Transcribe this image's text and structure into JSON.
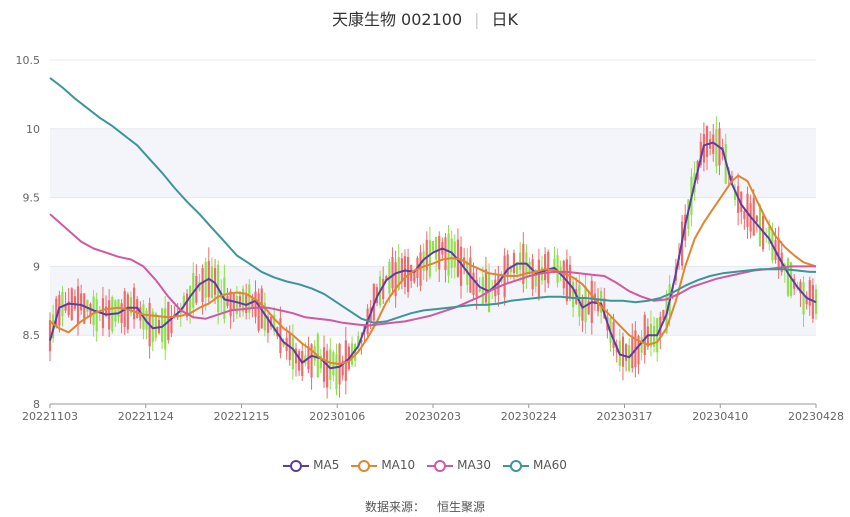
{
  "chart_data": {
    "type": "candlestick",
    "title": "天康生物 002100",
    "period_label": "日K",
    "ylim": [
      8,
      10.5
    ],
    "y_ticks": [
      "8",
      "8.5",
      "9",
      "9.5",
      "10",
      "10.5"
    ],
    "x_tick_labels": [
      "20221103",
      "20221124",
      "20221215",
      "20230106",
      "20230203",
      "20230224",
      "20230317",
      "20230410",
      "20230428"
    ],
    "grid": true,
    "legend_position": "bottom",
    "up_color": "#ef6b6b",
    "down_color": "#8fe04f",
    "series": [
      {
        "name": "MA5",
        "color": "#5b3ea3",
        "points": [
          [
            0,
            8.46
          ],
          [
            3,
            8.7
          ],
          [
            6,
            8.73
          ],
          [
            10,
            8.72
          ],
          [
            14,
            8.68
          ],
          [
            18,
            8.65
          ],
          [
            22,
            8.66
          ],
          [
            25,
            8.7
          ],
          [
            28,
            8.7
          ],
          [
            31,
            8.6
          ],
          [
            33,
            8.55
          ],
          [
            36,
            8.56
          ],
          [
            39,
            8.62
          ],
          [
            42,
            8.68
          ],
          [
            45,
            8.78
          ],
          [
            48,
            8.87
          ],
          [
            51,
            8.91
          ],
          [
            53,
            8.88
          ],
          [
            56,
            8.76
          ],
          [
            60,
            8.74
          ],
          [
            63,
            8.72
          ],
          [
            66,
            8.75
          ],
          [
            69,
            8.65
          ],
          [
            72,
            8.55
          ],
          [
            75,
            8.45
          ],
          [
            78,
            8.4
          ],
          [
            81,
            8.3
          ],
          [
            84,
            8.35
          ],
          [
            87,
            8.33
          ],
          [
            90,
            8.26
          ],
          [
            93,
            8.27
          ],
          [
            96,
            8.33
          ],
          [
            99,
            8.42
          ],
          [
            102,
            8.6
          ],
          [
            105,
            8.78
          ],
          [
            108,
            8.9
          ],
          [
            111,
            8.95
          ],
          [
            114,
            8.97
          ],
          [
            117,
            8.96
          ],
          [
            120,
            9.05
          ],
          [
            123,
            9.1
          ],
          [
            126,
            9.13
          ],
          [
            129,
            9.1
          ],
          [
            132,
            9.02
          ],
          [
            135,
            8.93
          ],
          [
            138,
            8.85
          ],
          [
            141,
            8.82
          ],
          [
            144,
            8.88
          ],
          [
            147,
            8.98
          ],
          [
            150,
            9.02
          ],
          [
            153,
            9.02
          ],
          [
            156,
            8.95
          ],
          [
            159,
            8.97
          ],
          [
            162,
            8.99
          ],
          [
            165,
            8.92
          ],
          [
            168,
            8.84
          ],
          [
            171,
            8.7
          ],
          [
            174,
            8.74
          ],
          [
            177,
            8.73
          ],
          [
            180,
            8.52
          ],
          [
            183,
            8.36
          ],
          [
            186,
            8.34
          ],
          [
            189,
            8.42
          ],
          [
            192,
            8.5
          ],
          [
            195,
            8.5
          ],
          [
            198,
            8.65
          ],
          [
            201,
            8.95
          ],
          [
            204,
            9.3
          ],
          [
            207,
            9.6
          ],
          [
            210,
            9.88
          ],
          [
            213,
            9.9
          ],
          [
            216,
            9.85
          ],
          [
            219,
            9.6
          ],
          [
            222,
            9.45
          ],
          [
            225,
            9.36
          ],
          [
            228,
            9.28
          ],
          [
            231,
            9.2
          ],
          [
            234,
            9.07
          ],
          [
            237,
            8.95
          ],
          [
            240,
            8.85
          ],
          [
            243,
            8.77
          ],
          [
            246,
            8.74
          ]
        ]
      },
      {
        "name": "MA10",
        "color": "#e0862e",
        "points": [
          [
            0,
            8.6
          ],
          [
            3,
            8.55
          ],
          [
            6,
            8.52
          ],
          [
            10,
            8.6
          ],
          [
            14,
            8.66
          ],
          [
            18,
            8.69
          ],
          [
            22,
            8.7
          ],
          [
            26,
            8.68
          ],
          [
            30,
            8.65
          ],
          [
            34,
            8.64
          ],
          [
            38,
            8.63
          ],
          [
            42,
            8.64
          ],
          [
            45,
            8.66
          ],
          [
            48,
            8.7
          ],
          [
            51,
            8.73
          ],
          [
            54,
            8.78
          ],
          [
            57,
            8.8
          ],
          [
            60,
            8.81
          ],
          [
            63,
            8.8
          ],
          [
            66,
            8.76
          ],
          [
            69,
            8.7
          ],
          [
            72,
            8.62
          ],
          [
            75,
            8.55
          ],
          [
            78,
            8.5
          ],
          [
            81,
            8.44
          ],
          [
            84,
            8.39
          ],
          [
            87,
            8.33
          ],
          [
            90,
            8.3
          ],
          [
            93,
            8.29
          ],
          [
            96,
            8.31
          ],
          [
            99,
            8.38
          ],
          [
            102,
            8.48
          ],
          [
            105,
            8.6
          ],
          [
            108,
            8.74
          ],
          [
            111,
            8.84
          ],
          [
            114,
            8.92
          ],
          [
            117,
            8.97
          ],
          [
            120,
            9.0
          ],
          [
            123,
            9.02
          ],
          [
            126,
            9.05
          ],
          [
            129,
            9.06
          ],
          [
            132,
            9.05
          ],
          [
            135,
            9.01
          ],
          [
            138,
            8.98
          ],
          [
            141,
            8.95
          ],
          [
            144,
            8.94
          ],
          [
            147,
            8.93
          ],
          [
            150,
            8.93
          ],
          [
            153,
            8.95
          ],
          [
            156,
            8.96
          ],
          [
            159,
            8.98
          ],
          [
            162,
            8.97
          ],
          [
            165,
            8.95
          ],
          [
            168,
            8.92
          ],
          [
            171,
            8.87
          ],
          [
            174,
            8.79
          ],
          [
            177,
            8.71
          ],
          [
            180,
            8.64
          ],
          [
            183,
            8.57
          ],
          [
            186,
            8.5
          ],
          [
            189,
            8.46
          ],
          [
            192,
            8.43
          ],
          [
            195,
            8.45
          ],
          [
            198,
            8.55
          ],
          [
            201,
            8.75
          ],
          [
            204,
            9.0
          ],
          [
            207,
            9.2
          ],
          [
            210,
            9.32
          ],
          [
            213,
            9.42
          ],
          [
            216,
            9.52
          ],
          [
            219,
            9.62
          ],
          [
            221,
            9.66
          ],
          [
            224,
            9.62
          ],
          [
            227,
            9.48
          ],
          [
            230,
            9.34
          ],
          [
            233,
            9.22
          ],
          [
            236,
            9.14
          ],
          [
            239,
            9.08
          ],
          [
            242,
            9.03
          ],
          [
            246,
            9.0
          ]
        ]
      },
      {
        "name": "MA30",
        "color": "#d258a0",
        "points": [
          [
            0,
            9.38
          ],
          [
            5,
            9.28
          ],
          [
            10,
            9.18
          ],
          [
            14,
            9.13
          ],
          [
            18,
            9.1
          ],
          [
            22,
            9.07
          ],
          [
            26,
            9.05
          ],
          [
            30,
            9.0
          ],
          [
            34,
            8.9
          ],
          [
            38,
            8.78
          ],
          [
            42,
            8.68
          ],
          [
            46,
            8.63
          ],
          [
            50,
            8.62
          ],
          [
            54,
            8.65
          ],
          [
            58,
            8.68
          ],
          [
            62,
            8.69
          ],
          [
            66,
            8.7
          ],
          [
            70,
            8.7
          ],
          [
            74,
            8.68
          ],
          [
            78,
            8.66
          ],
          [
            82,
            8.63
          ],
          [
            86,
            8.62
          ],
          [
            90,
            8.61
          ],
          [
            94,
            8.59
          ],
          [
            98,
            8.58
          ],
          [
            102,
            8.57
          ],
          [
            106,
            8.58
          ],
          [
            110,
            8.59
          ],
          [
            114,
            8.6
          ],
          [
            118,
            8.62
          ],
          [
            122,
            8.64
          ],
          [
            126,
            8.67
          ],
          [
            130,
            8.7
          ],
          [
            134,
            8.74
          ],
          [
            138,
            8.78
          ],
          [
            142,
            8.83
          ],
          [
            146,
            8.87
          ],
          [
            150,
            8.9
          ],
          [
            154,
            8.93
          ],
          [
            158,
            8.95
          ],
          [
            162,
            8.96
          ],
          [
            166,
            8.96
          ],
          [
            170,
            8.95
          ],
          [
            174,
            8.94
          ],
          [
            178,
            8.93
          ],
          [
            182,
            8.88
          ],
          [
            186,
            8.82
          ],
          [
            190,
            8.78
          ],
          [
            194,
            8.75
          ],
          [
            198,
            8.76
          ],
          [
            202,
            8.8
          ],
          [
            206,
            8.85
          ],
          [
            210,
            8.88
          ],
          [
            214,
            8.91
          ],
          [
            218,
            8.93
          ],
          [
            222,
            8.95
          ],
          [
            226,
            8.97
          ],
          [
            230,
            8.98
          ],
          [
            234,
            8.99
          ],
          [
            238,
            9.0
          ],
          [
            242,
            9.0
          ],
          [
            246,
            9.0
          ]
        ]
      },
      {
        "name": "MA60",
        "color": "#3d9598",
        "points": [
          [
            0,
            10.37
          ],
          [
            4,
            10.3
          ],
          [
            8,
            10.22
          ],
          [
            12,
            10.15
          ],
          [
            16,
            10.08
          ],
          [
            20,
            10.02
          ],
          [
            24,
            9.95
          ],
          [
            28,
            9.88
          ],
          [
            32,
            9.78
          ],
          [
            36,
            9.68
          ],
          [
            40,
            9.57
          ],
          [
            44,
            9.47
          ],
          [
            48,
            9.38
          ],
          [
            52,
            9.28
          ],
          [
            56,
            9.18
          ],
          [
            60,
            9.08
          ],
          [
            64,
            9.02
          ],
          [
            68,
            8.96
          ],
          [
            72,
            8.92
          ],
          [
            76,
            8.89
          ],
          [
            80,
            8.87
          ],
          [
            84,
            8.84
          ],
          [
            88,
            8.8
          ],
          [
            92,
            8.74
          ],
          [
            96,
            8.68
          ],
          [
            100,
            8.62
          ],
          [
            104,
            8.59
          ],
          [
            108,
            8.6
          ],
          [
            112,
            8.63
          ],
          [
            116,
            8.66
          ],
          [
            120,
            8.68
          ],
          [
            124,
            8.69
          ],
          [
            128,
            8.7
          ],
          [
            132,
            8.71
          ],
          [
            136,
            8.72
          ],
          [
            140,
            8.72
          ],
          [
            144,
            8.73
          ],
          [
            148,
            8.75
          ],
          [
            152,
            8.76
          ],
          [
            156,
            8.77
          ],
          [
            160,
            8.78
          ],
          [
            164,
            8.78
          ],
          [
            168,
            8.77
          ],
          [
            172,
            8.77
          ],
          [
            176,
            8.76
          ],
          [
            180,
            8.75
          ],
          [
            184,
            8.75
          ],
          [
            188,
            8.74
          ],
          [
            192,
            8.75
          ],
          [
            196,
            8.77
          ],
          [
            200,
            8.81
          ],
          [
            204,
            8.86
          ],
          [
            208,
            8.9
          ],
          [
            212,
            8.93
          ],
          [
            216,
            8.95
          ],
          [
            220,
            8.96
          ],
          [
            224,
            8.97
          ],
          [
            228,
            8.98
          ],
          [
            232,
            8.98
          ],
          [
            236,
            8.98
          ],
          [
            240,
            8.97
          ],
          [
            244,
            8.96
          ],
          [
            246,
            8.96
          ]
        ]
      }
    ]
  },
  "legend": [
    {
      "label": "MA5",
      "color": "#5b3ea3"
    },
    {
      "label": "MA10",
      "color": "#e0862e"
    },
    {
      "label": "MA30",
      "color": "#d258a0"
    },
    {
      "label": "MA60",
      "color": "#3d9598"
    }
  ],
  "source": {
    "label": "数据来源：",
    "name": "恒生聚源"
  }
}
